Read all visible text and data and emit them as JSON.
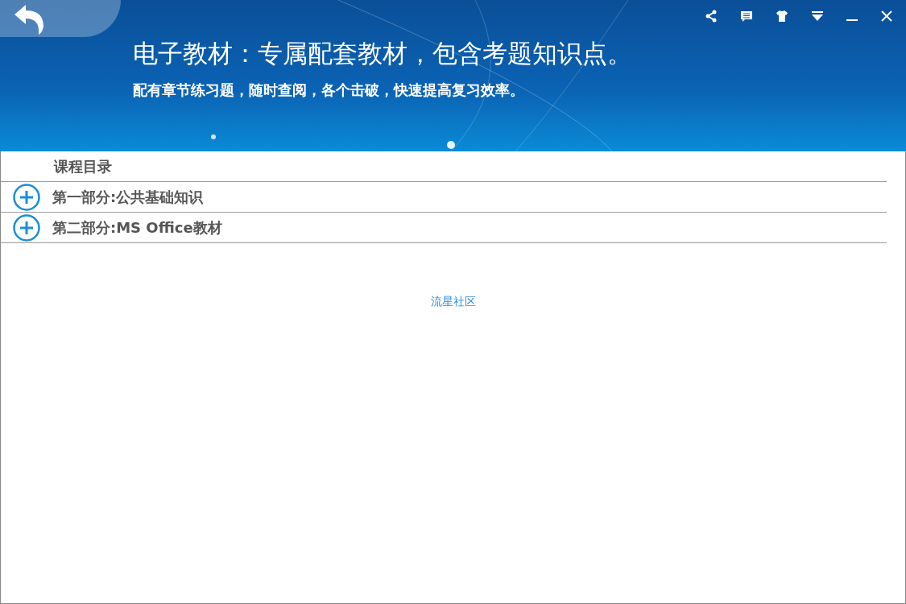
{
  "header": {
    "title": "电子教材：专属配套教材，包含考题知识点。",
    "subtitle": "配有章节练习题，随时查阅，各个击破，快速提高复习效率。"
  },
  "catalog": {
    "heading": "课程目录",
    "items": [
      {
        "label": "第一部分:公共基础知识",
        "expanded": false
      },
      {
        "label": "第二部分:MS Office教材",
        "expanded": false
      }
    ]
  },
  "footer_link": "流星社区"
}
